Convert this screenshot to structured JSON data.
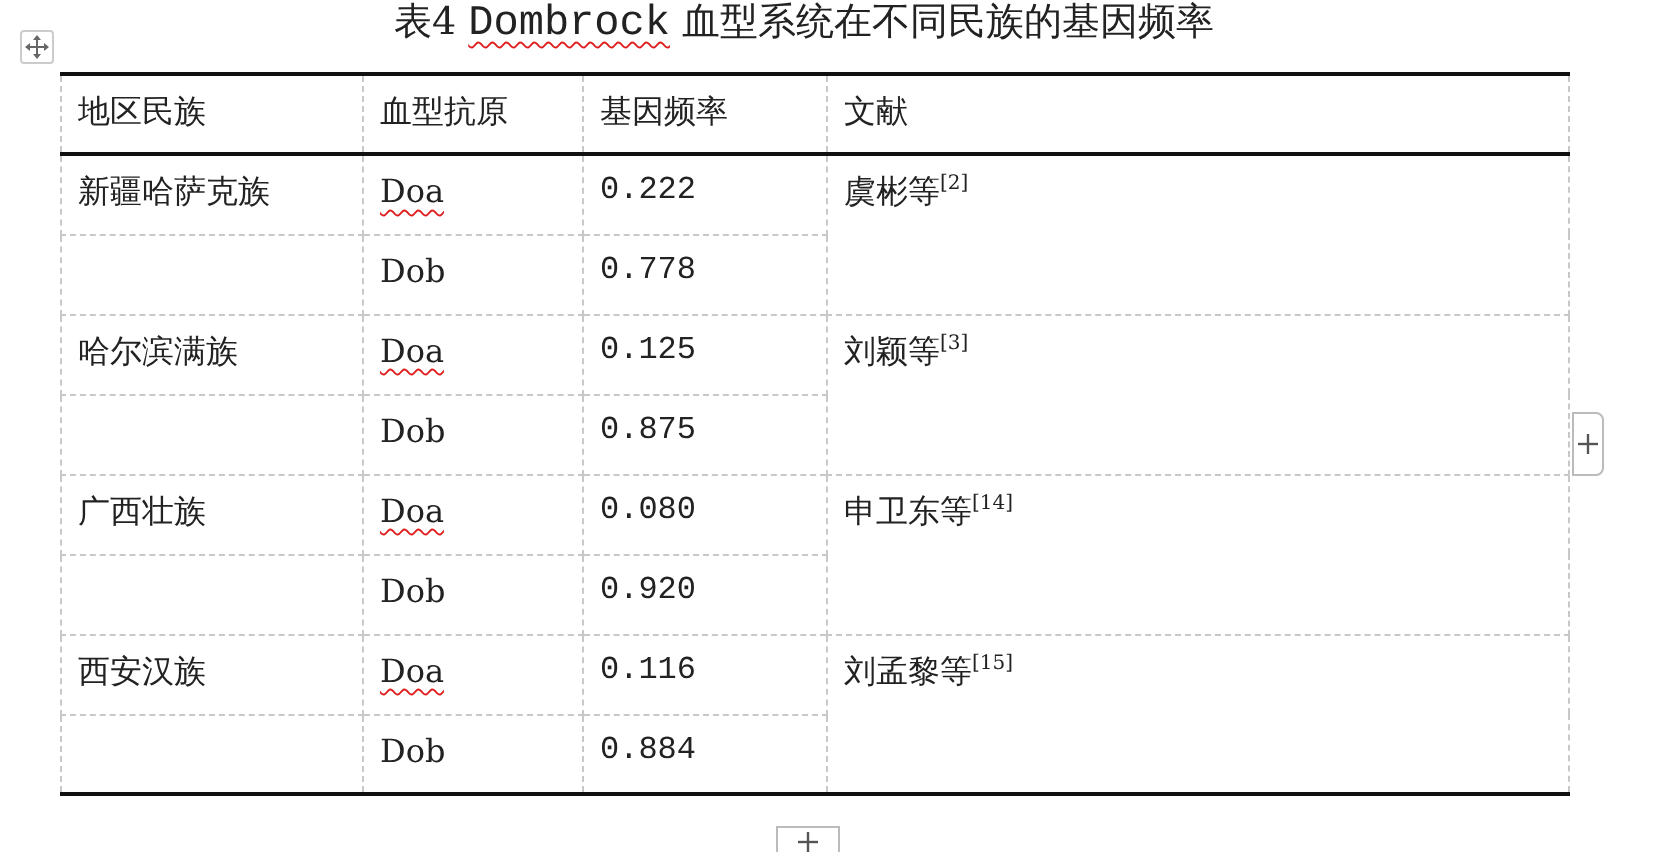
{
  "title_parts": [
    {
      "text": "表4 ",
      "misspelled": false
    },
    {
      "text": "Dombrock",
      "misspelled": true
    },
    {
      "text": " 血型系统在不同民族的基因频率",
      "misspelled": false
    }
  ],
  "table": {
    "columns": [
      "地区民族",
      "血型抗原",
      "基因频率",
      "文献"
    ],
    "groups": [
      {
        "population": "新疆哈萨克族",
        "reference": "虞彬等$^{[2]}$",
        "rows": [
          {
            "antigen": "Doa",
            "misspelled": true,
            "frequency": "0.222"
          },
          {
            "antigen": "Dob",
            "misspelled": false,
            "frequency": "0.778"
          }
        ]
      },
      {
        "population": "哈尔滨满族",
        "reference": "刘颖等$^{[3]}$",
        "rows": [
          {
            "antigen": "Doa",
            "misspelled": true,
            "frequency": "0.125"
          },
          {
            "antigen": "Dob",
            "misspelled": false,
            "frequency": "0.875"
          }
        ]
      },
      {
        "population": "广西壮族",
        "reference": "申卫东等$^{[14]}$",
        "rows": [
          {
            "antigen": "Doa",
            "misspelled": true,
            "frequency": "0.080"
          },
          {
            "antigen": "Dob",
            "misspelled": false,
            "frequency": "0.920"
          }
        ]
      },
      {
        "population": "西安汉族",
        "reference": "刘孟黎等$^{[15]}$",
        "rows": [
          {
            "antigen": "Doa",
            "misspelled": true,
            "frequency": "0.116"
          },
          {
            "antigen": "Dob",
            "misspelled": false,
            "frequency": "0.884"
          }
        ]
      }
    ]
  }
}
